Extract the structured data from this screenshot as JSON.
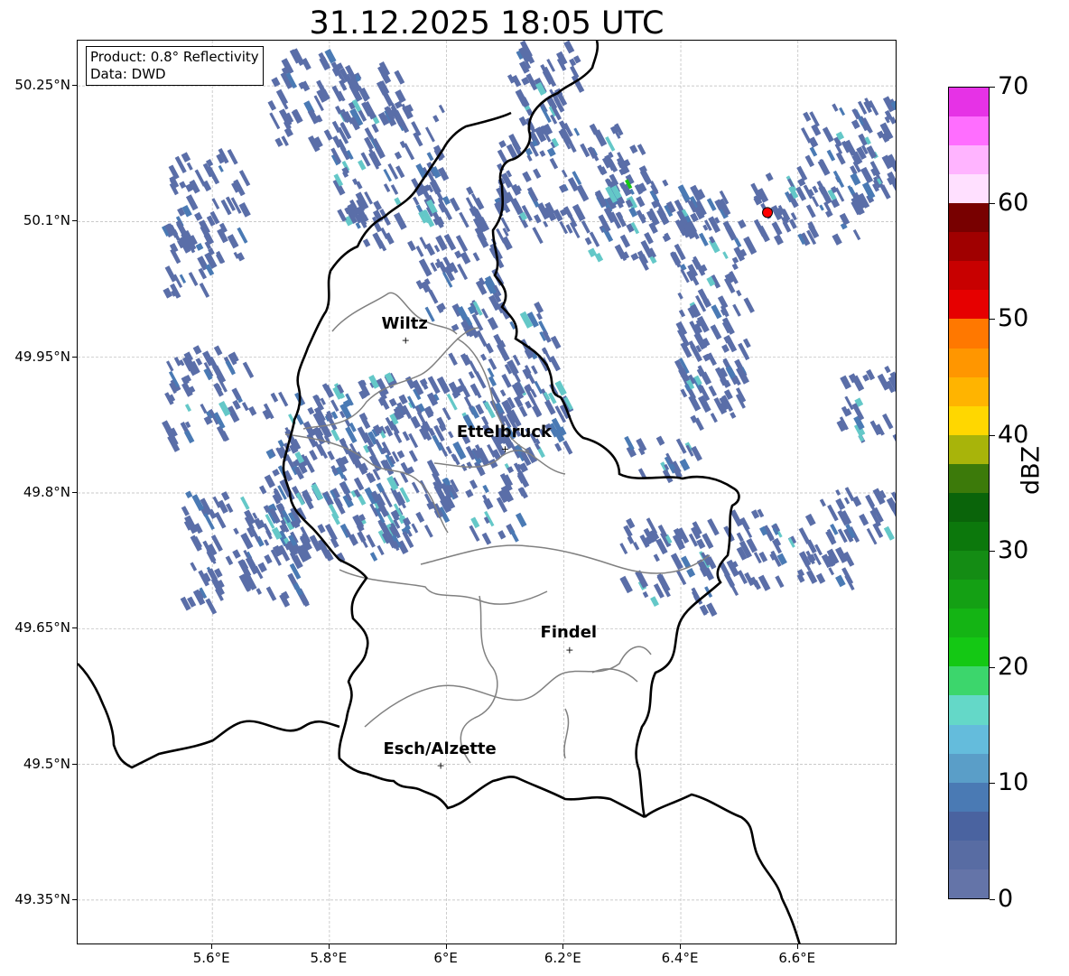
{
  "title": "31.12.2025 18:05 UTC",
  "info": {
    "product": "Product: 0.8° Reflectivity",
    "data_source": "Data: DWD"
  },
  "axes": {
    "lat_labels": [
      "50.25°N",
      "50.1°N",
      "49.95°N",
      "49.8°N",
      "49.65°N",
      "49.5°N",
      "49.35°N"
    ],
    "lat_values": [
      50.25,
      50.1,
      49.95,
      49.8,
      49.65,
      49.5,
      49.35
    ],
    "lon_labels": [
      "5.6°E",
      "5.8°E",
      "6°E",
      "6.2°E",
      "6.4°E",
      "6.6°E"
    ],
    "lon_values": [
      5.6,
      5.8,
      6.0,
      6.2,
      6.4,
      6.6
    ],
    "lat_range": [
      49.3,
      50.3
    ],
    "lon_range": [
      5.37,
      6.77
    ]
  },
  "cities": [
    {
      "name": "Wiltz",
      "lon": 5.93,
      "lat": 49.969
    },
    {
      "name": "Ettelbruck",
      "lon": 6.1,
      "lat": 49.849
    },
    {
      "name": "Findel",
      "lon": 6.21,
      "lat": 49.627
    },
    {
      "name": "Esch/Alzette",
      "lon": 5.99,
      "lat": 49.499
    }
  ],
  "radar_site": {
    "lon": 6.548,
    "lat": 50.11,
    "color": "#ff0000"
  },
  "colorbar": {
    "label": "dBZ",
    "tick_labels": [
      "0",
      "10",
      "20",
      "30",
      "40",
      "50",
      "60",
      "70"
    ],
    "min": 0,
    "max": 70,
    "step": 2.5,
    "colors": [
      "#6474a8",
      "#586ca3",
      "#4a63a0",
      "#4a7ab4",
      "#5a9ec8",
      "#64bcdc",
      "#64d8c8",
      "#3cd66c",
      "#14c814",
      "#14b414",
      "#14a014",
      "#148c14",
      "#0c780c",
      "#0a640a",
      "#3c7a0a",
      "#a8b40a",
      "#ffd700",
      "#ffb400",
      "#ff9600",
      "#ff7800",
      "#e60000",
      "#c80000",
      "#a00000",
      "#780000",
      "#ffe0ff",
      "#ffb4ff",
      "#ff6eff",
      "#e632e6"
    ]
  },
  "echo_colors": {
    "light": "#5a6ea8",
    "mid": "#4a7ab4",
    "high": "#64c8c8",
    "peak": "#14c814"
  }
}
